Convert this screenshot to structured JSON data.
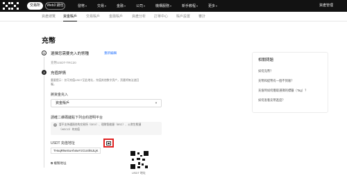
{
  "topnav": {
    "pill_exchange": "交易所",
    "pill_web3": "Web3 錢包",
    "items": [
      "發幣",
      "交易",
      "金融",
      "公司",
      "機構服務",
      "新手教程",
      "更多"
    ],
    "right": "資產管理"
  },
  "subnav": {
    "tabs": [
      "資產總覽",
      "資金賬戶",
      "交易賬戶",
      "金融賬戶",
      "資產分析",
      "訂單中心",
      "賬戶設置",
      "審計"
    ],
    "active_index": 1
  },
  "page": {
    "title": "充幣",
    "step1": {
      "number": "1",
      "title": "選擇您需要充入的幣種",
      "link": "重新編輯",
      "value": "充幣USDT-TRC20"
    },
    "step2": {
      "number": "2",
      "title": "充值詳情",
      "desc_line1": "重要提示：仅可充值USDT至此地址，充值其他数字资产，资產将無法追回",
      "desc_line2": "喔。",
      "deposit_to_label": "將資金充入",
      "deposit_to_value": "資金賬戶",
      "network_label": "請確二維碼鏈點下列合約證明平台",
      "notice_line1": "暫不支持通過合約交易所（DEX）、理財智能鏈（BSC）、火幣生態鏈",
      "notice_line2": "（HECO）的充值",
      "address_label": "USDT 充值地址",
      "address_value": "THxqRNeSoAh4wYzCU4h5JLjK",
      "copy_label": "複製地址",
      "qr_caption": "USDT 地址"
    }
  },
  "faq": {
    "title": "相關問題",
    "items": [
      "如何充幣？",
      "充幣和提幣有一個不到賬？",
      "充值時如何獲取選擇的標籤（Tag）？",
      "如何查看充幣進度？"
    ]
  },
  "colors": {
    "accent_link": "#1f6fff",
    "highlight_border": "#e02020",
    "topbar_bg": "#121212"
  }
}
